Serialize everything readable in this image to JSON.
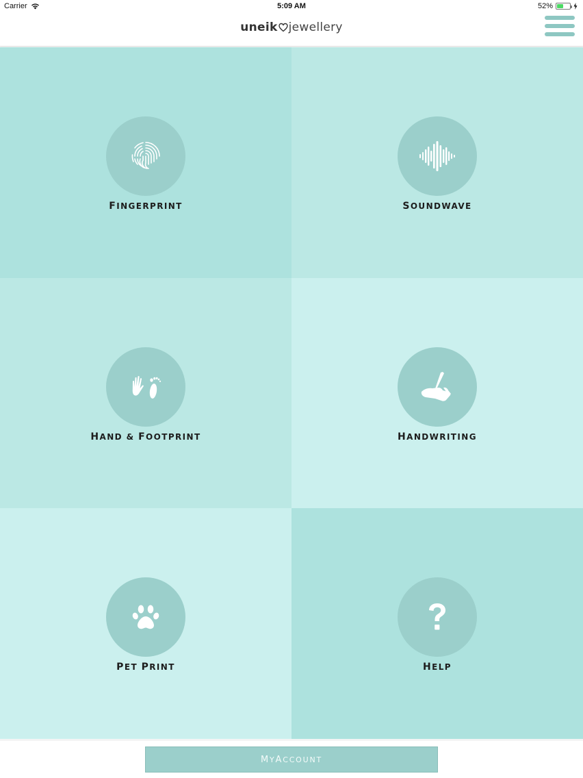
{
  "status": {
    "carrier": "Carrier",
    "time": "5:09 AM",
    "battery_text": "52%",
    "battery_level": 0.52
  },
  "header": {
    "brand_left": "uneik",
    "brand_right": "jewellery"
  },
  "tiles": [
    {
      "first": "F",
      "rest": "INGERPRINT",
      "icon": "fingerprint-icon",
      "color": "#ade2de"
    },
    {
      "first": "S",
      "rest": "OUNDWAVE",
      "icon": "soundwave-icon",
      "color": "#bbe8e4"
    },
    {
      "first": "H",
      "rest": "AND & ",
      "first2": "F",
      "rest2": "OOTPRINT",
      "icon": "hand-foot-icon",
      "color": "#bbe8e4"
    },
    {
      "first": "H",
      "rest": "ANDWRITING",
      "icon": "pen-hand-icon",
      "color": "#cbf0ee"
    },
    {
      "first": "P",
      "rest": "ET ",
      "first2": "P",
      "rest2": "RINT",
      "icon": "paw-icon",
      "color": "#cbf0ee"
    },
    {
      "first": "H",
      "rest": "ELP",
      "icon": "question-icon",
      "color": "#ade2de"
    }
  ],
  "footer": {
    "account_first": "M",
    "account_mid": "Y ",
    "account_first2": "A",
    "account_rest": "CCOUNT"
  },
  "colors": {
    "circle": "#9bcfcb",
    "accent": "#8ec7c2"
  }
}
